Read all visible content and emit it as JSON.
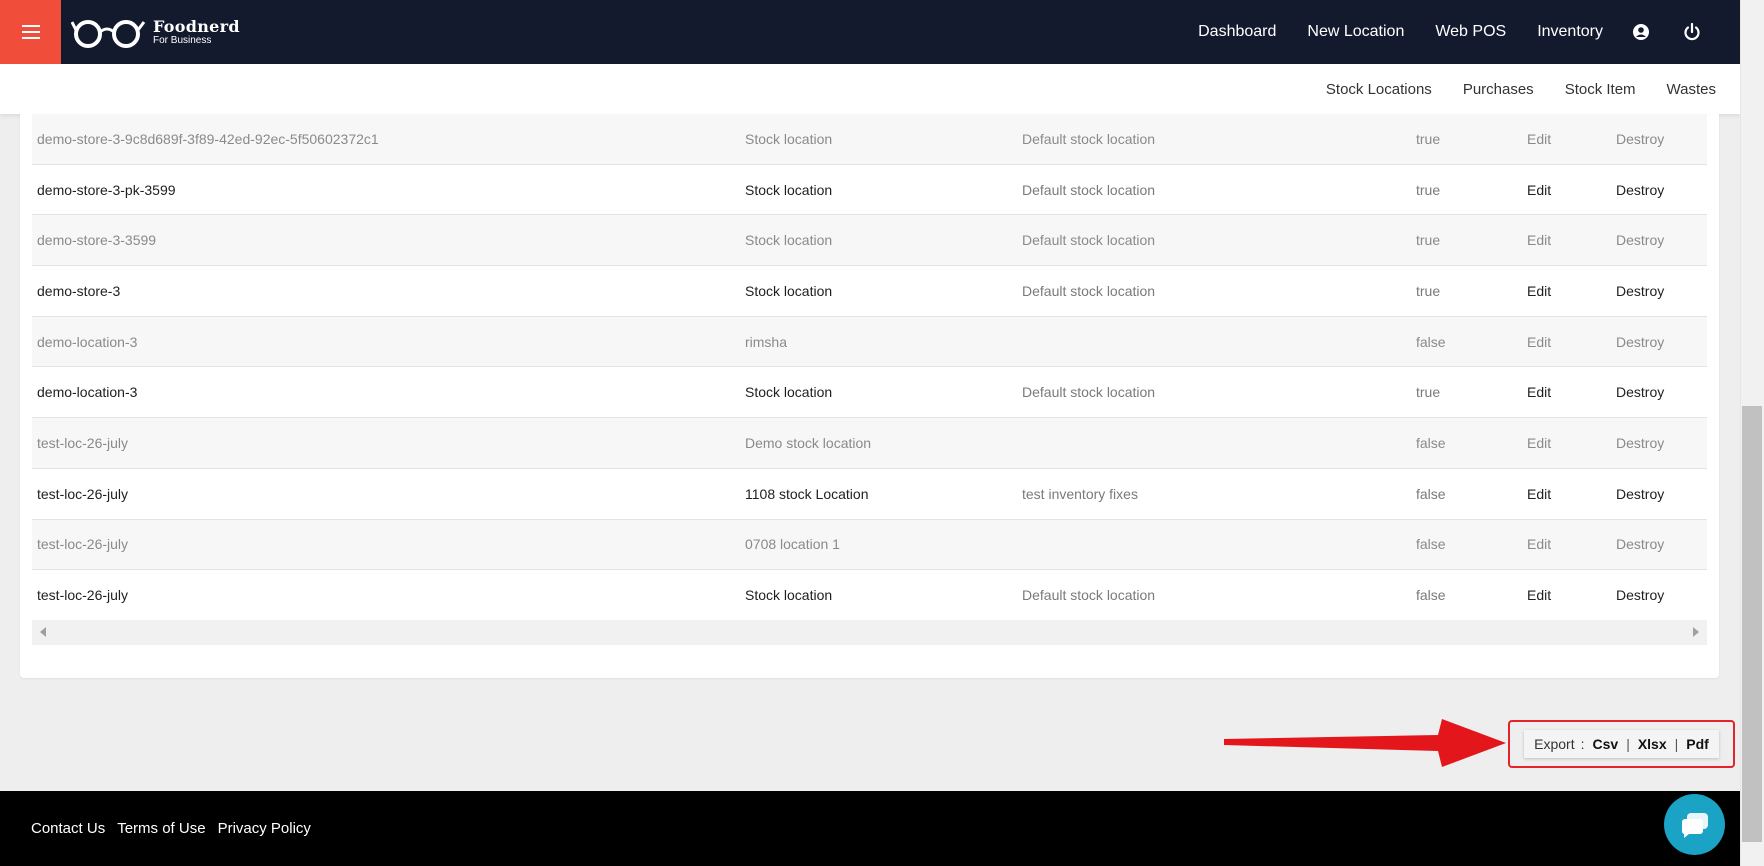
{
  "header": {
    "brand": "Foodnerd",
    "brand_sub": "For Business",
    "nav": [
      "Dashboard",
      "New Location",
      "Web POS",
      "Inventory"
    ]
  },
  "subnav": [
    "Stock Locations",
    "Purchases",
    "Stock Item",
    "Wastes"
  ],
  "table": {
    "rows": [
      {
        "location": "demo-store-3-9c8d689f-3f89-42ed-92ec-5f50602372c1",
        "name": "Stock location",
        "description": "Default stock location",
        "active": "true",
        "edit": "Edit",
        "destroy": "Destroy"
      },
      {
        "location": "demo-store-3-pk-3599",
        "name": "Stock location",
        "description": "Default stock location",
        "active": "true",
        "edit": "Edit",
        "destroy": "Destroy"
      },
      {
        "location": "demo-store-3-3599",
        "name": "Stock location",
        "description": "Default stock location",
        "active": "true",
        "edit": "Edit",
        "destroy": "Destroy"
      },
      {
        "location": "demo-store-3",
        "name": "Stock location",
        "description": "Default stock location",
        "active": "true",
        "edit": "Edit",
        "destroy": "Destroy"
      },
      {
        "location": "demo-location-3",
        "name": "rimsha",
        "description": "",
        "active": "false",
        "edit": "Edit",
        "destroy": "Destroy"
      },
      {
        "location": "demo-location-3",
        "name": "Stock location",
        "description": "Default stock location",
        "active": "true",
        "edit": "Edit",
        "destroy": "Destroy"
      },
      {
        "location": "test-loc-26-july",
        "name": "Demo stock location",
        "description": "",
        "active": "false",
        "edit": "Edit",
        "destroy": "Destroy"
      },
      {
        "location": "test-loc-26-july",
        "name": "1108 stock Location",
        "description": "test inventory fixes",
        "active": "false",
        "edit": "Edit",
        "destroy": "Destroy"
      },
      {
        "location": "test-loc-26-july",
        "name": "0708 location 1",
        "description": "",
        "active": "false",
        "edit": "Edit",
        "destroy": "Destroy"
      },
      {
        "location": "test-loc-26-july",
        "name": "Stock location",
        "description": "Default stock location",
        "active": "false",
        "edit": "Edit",
        "destroy": "Destroy"
      }
    ]
  },
  "export": {
    "label": "Export",
    "colon": ":",
    "options": [
      "Csv",
      "Xlsx",
      "Pdf"
    ],
    "separator": "|"
  },
  "footer": {
    "links": [
      "Contact Us",
      "Terms of Use",
      "Privacy Policy"
    ]
  },
  "icons": {
    "menu": "menu-icon",
    "logo": "glasses-logo-icon",
    "account": "user-circle-icon",
    "power": "power-icon",
    "chat": "chat-bubble-icon",
    "annotation": "red-arrow-icon"
  },
  "colors": {
    "topbar": "#141a2e",
    "menu_button": "#f04e3a",
    "highlight": "#e5232a",
    "chat": "#1aa3c4"
  }
}
